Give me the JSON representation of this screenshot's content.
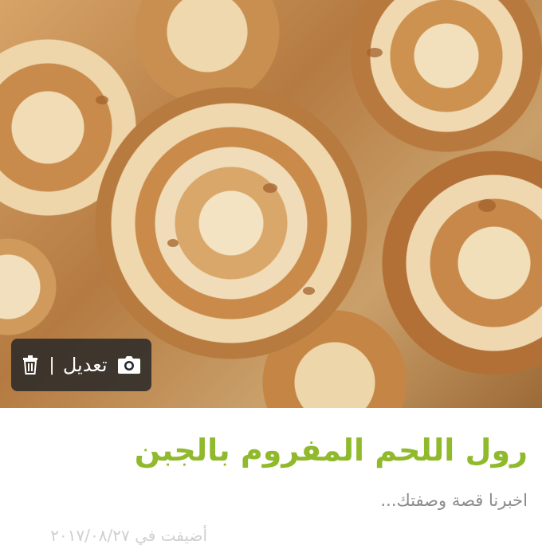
{
  "photo": {
    "alt_icon": "dish-photo"
  },
  "edit_bar": {
    "edit_label": "تعديل",
    "separator": "|",
    "camera_icon": "camera-icon",
    "trash_icon": "trash-icon"
  },
  "recipe": {
    "title": "رول اللحم المفروم بالجبن",
    "story_prompt": "اخبرنا قصة وصفتك...",
    "added_on": "أضيفت في ٢٠١٧/٠٨/٢٧"
  },
  "colors": {
    "title_green": "#90b92c",
    "overlay": "#282828"
  }
}
